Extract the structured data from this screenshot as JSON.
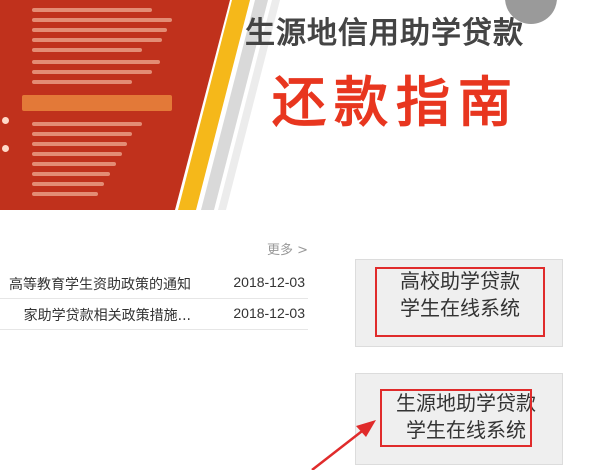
{
  "banner": {
    "subtitle": "生源地信用助学贷款",
    "title": "还款指南"
  },
  "news": {
    "more_label": "更多 >",
    "items": [
      {
        "title": "高等教育学生资助政策的通知",
        "date": "2018-12-03"
      },
      {
        "title": "家助学贷款相关政策措施...",
        "date": "2018-12-03"
      }
    ]
  },
  "systems": [
    {
      "line1": "高校助学贷款",
      "line2": "学生在线系统"
    },
    {
      "line1": "生源地助学贷款",
      "line2": "学生在线系统"
    }
  ],
  "colors": {
    "banner_red": "#c0311c",
    "title_red": "#e8361f",
    "stripe_yellow": "#f5b81a",
    "highlight_border": "#e02b2b"
  }
}
